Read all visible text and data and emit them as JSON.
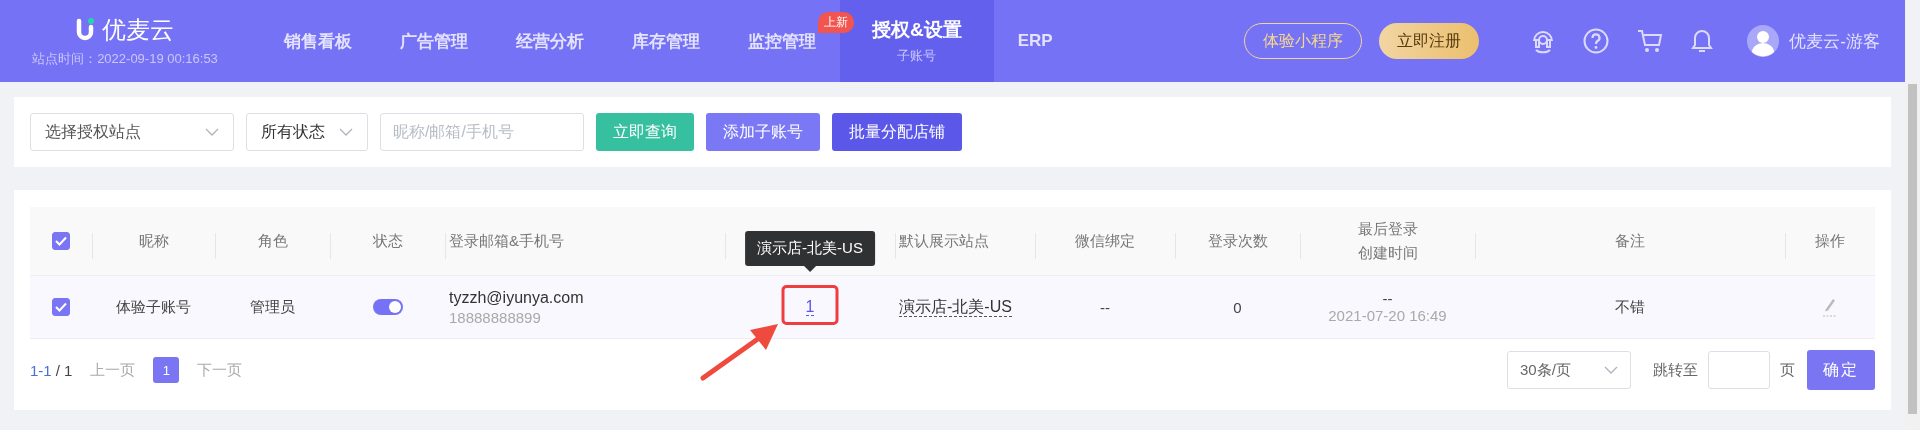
{
  "header": {
    "logo": "优麦云",
    "site_time": "站点时间：2022-09-19 00:16:53",
    "nav": [
      {
        "label": "销售看板",
        "selected": false
      },
      {
        "label": "广告管理",
        "selected": false
      },
      {
        "label": "经营分析",
        "selected": false
      },
      {
        "label": "库存管理",
        "selected": false
      },
      {
        "label": "监控管理",
        "selected": false,
        "badge": "上新"
      },
      {
        "label": "授权&设置",
        "selected": true,
        "sublabel": "子账号"
      },
      {
        "label": "ERP",
        "selected": false
      }
    ],
    "mini_program_button": "体验小程序",
    "register_button": "立即注册",
    "user_name": "优麦云-游客"
  },
  "filters": {
    "site_select": {
      "placeholder": "选择授权站点"
    },
    "status_select": {
      "value": "所有状态"
    },
    "search": {
      "placeholder": "昵称/邮箱/手机号"
    },
    "buttons": [
      {
        "label": "立即查询",
        "kind": "query"
      },
      {
        "label": "添加子账号",
        "kind": "add"
      },
      {
        "label": "批量分配店铺",
        "kind": "batch"
      }
    ]
  },
  "table": {
    "select_all_checked": true,
    "columns": [
      [
        "昵称"
      ],
      [
        "角色"
      ],
      [
        "状态"
      ],
      [
        "登录邮箱&手机号"
      ],
      [
        "默认展示站点"
      ],
      [
        "微信绑定"
      ],
      [
        "登录次数"
      ],
      [
        "最后登录",
        "创建时间"
      ],
      [
        "备注"
      ],
      [
        "操作"
      ]
    ],
    "rows": [
      {
        "checked": true,
        "nickname": "体验子账号",
        "role": "管理员",
        "enabled": true,
        "email": "tyzzh@iyunya.com",
        "phone": "18888888899",
        "store_count": "1",
        "tooltip": "演示店-北美-US",
        "default_site": "演示店-北美-US",
        "wechat": "--",
        "login_count": "0",
        "last_login": "--",
        "created": "2021-07-20 16:49",
        "remark": "不错"
      }
    ]
  },
  "pagination": {
    "range": "1-1",
    "total": "/ 1",
    "prev": {
      "label": "上一页",
      "disabled": true
    },
    "pages": [
      {
        "label": "1",
        "selected": true
      }
    ],
    "next": {
      "label": "下一页",
      "disabled": true
    },
    "page_size": "30条/页",
    "jump_label": "跳转至",
    "page_unit": "页",
    "confirm": "确定"
  }
}
